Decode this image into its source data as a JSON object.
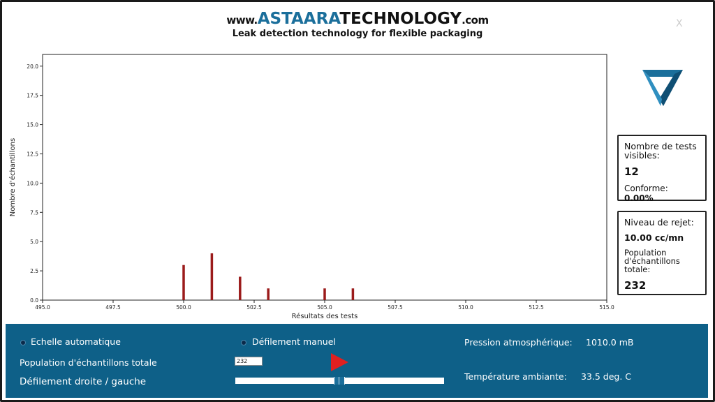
{
  "header": {
    "url_prefix": "www.",
    "brand_part1": "ASTAARA",
    "brand_part2": "TECHNOLOGY",
    "url_suffix": ".com",
    "tagline": "Leak detection technology for flexible packaging",
    "close_label": "X"
  },
  "colors": {
    "bar": "#9b1b1b",
    "panel": "#0e6088",
    "brand_blue": "#1b6f9b"
  },
  "chart_data": {
    "type": "bar",
    "title": "",
    "xlabel": "Résultats des tests",
    "ylabel": "Nombre d'échantillons",
    "xlim": [
      495.0,
      515.0
    ],
    "ylim": [
      0.0,
      21.0
    ],
    "x_ticks": [
      "495.0",
      "497.5",
      "500.0",
      "502.5",
      "505.0",
      "507.5",
      "510.0",
      "512.5",
      "515.0"
    ],
    "y_ticks": [
      "0.0",
      "2.5",
      "5.0",
      "7.5",
      "10.0",
      "12.5",
      "15.0",
      "17.5",
      "20.0"
    ],
    "x": [
      500,
      501,
      502,
      503,
      505,
      506
    ],
    "values": [
      3,
      4,
      2,
      1,
      1,
      1
    ]
  },
  "stats": {
    "visible_title": "Nombre de tests visibles:",
    "visible_count": "12",
    "conforme_label": "Conforme:",
    "conforme_value": "0.00%",
    "reject_title": "Niveau de rejet:",
    "reject_value": "10.00 cc/mn",
    "population_label": "Population d'échantillons totale:",
    "population_value": "232"
  },
  "controls": {
    "auto_scale_label": "Echelle automatique",
    "manual_scroll_label": "Défilement manuel",
    "population_label": "Population d'échantillons totale",
    "population_input": "232",
    "scroll_label": "Défilement droite / gauche",
    "pressure_label": "Pression atmosphérique:",
    "pressure_value": "1010.0 mB",
    "temp_label": "Température ambiante:",
    "temp_value": "33.5 deg. C"
  }
}
